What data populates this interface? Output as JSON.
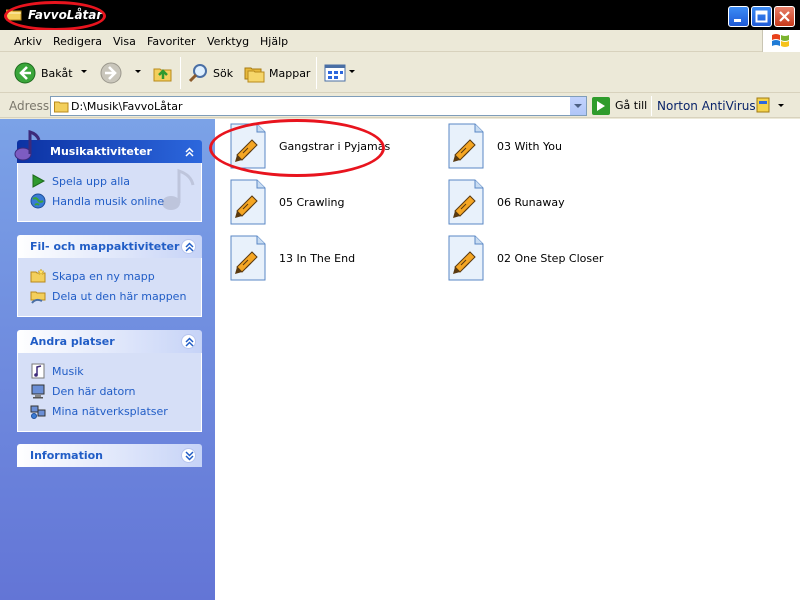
{
  "window": {
    "title": "FavvoLåtar"
  },
  "menu": {
    "items": [
      "Arkiv",
      "Redigera",
      "Visa",
      "Favoriter",
      "Verktyg",
      "Hjälp"
    ]
  },
  "toolbar": {
    "back_label": "Bakåt",
    "search_label": "Sök",
    "folders_label": "Mappar"
  },
  "address": {
    "label": "Adress",
    "path": "D:\\Musik\\FavvoLåtar",
    "go_label": "Gå till",
    "norton_label": "Norton AntiVirus"
  },
  "taskpane": {
    "panels": [
      {
        "title": "Musikaktiviteter",
        "tasks": [
          "Spela upp alla",
          "Handla musik online"
        ]
      },
      {
        "title": "Fil- och mappaktiviteter",
        "tasks": [
          "Skapa en ny mapp",
          "Dela ut den här mappen"
        ]
      },
      {
        "title": "Andra platser",
        "tasks": [
          "Musik",
          "Den här datorn",
          "Mina nätverksplatser"
        ]
      },
      {
        "title": "Information",
        "tasks": []
      }
    ]
  },
  "files": [
    {
      "name": "Gangstrar i Pyjamas"
    },
    {
      "name": "03 With You"
    },
    {
      "name": "05 Crawling"
    },
    {
      "name": "06 Runaway"
    },
    {
      "name": "13 In The End"
    },
    {
      "name": "02 One Step Closer"
    }
  ],
  "colors": {
    "title_bar": "#000000",
    "annotation_red": "#e8141e",
    "task_pane_top": "#7ba2e7",
    "task_pane_bottom": "#6375d6",
    "task_link": "#215dc6"
  }
}
